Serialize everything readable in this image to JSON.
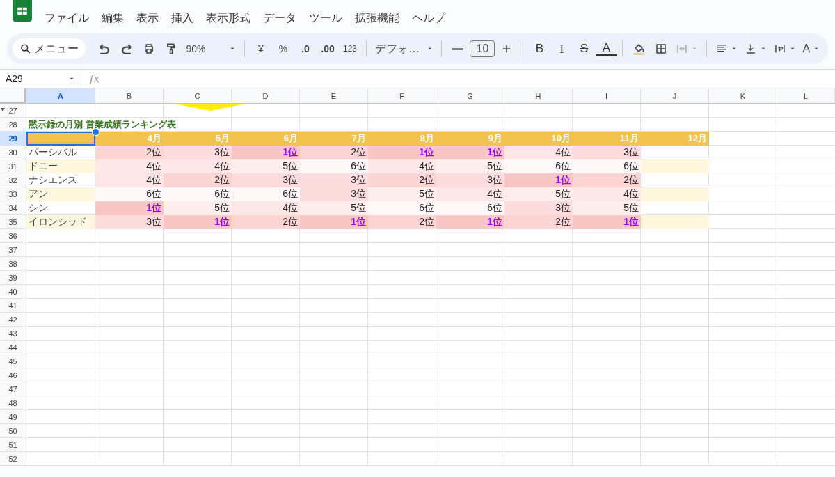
{
  "menu": [
    "ファイル",
    "編集",
    "表示",
    "挿入",
    "表示形式",
    "データ",
    "ツール",
    "拡張機能",
    "ヘルプ"
  ],
  "toolbar": {
    "search": "メニュー",
    "zoom": "90%",
    "currency": "¥",
    "percent": "%",
    "decrease_decimal": ".0",
    "increase_decimal": ".00",
    "number_format": "123",
    "font": "デフォ…",
    "font_size": "10",
    "bold": "B",
    "italic": "I",
    "strike": "S",
    "text_color": "A",
    "rotate": "A"
  },
  "name_box": "A29",
  "formula_label": "fx",
  "columns": [
    {
      "label": "A",
      "selected": true
    },
    {
      "label": "B",
      "selected": false
    },
    {
      "label": "C",
      "selected": false
    },
    {
      "label": "D",
      "selected": false
    },
    {
      "label": "E",
      "selected": false
    },
    {
      "label": "F",
      "selected": false
    },
    {
      "label": "G",
      "selected": false
    },
    {
      "label": "H",
      "selected": false
    },
    {
      "label": "I",
      "selected": false
    },
    {
      "label": "J",
      "selected": false
    },
    {
      "label": "K",
      "selected": false
    },
    {
      "label": "L",
      "selected": false
    }
  ],
  "rows": [
    {
      "number": "27",
      "kind": "empty",
      "selected": false
    },
    {
      "number": "28",
      "kind": "title",
      "selected": false,
      "title": "黙示録の月別 営業成績ランキング表"
    },
    {
      "number": "29",
      "kind": "header",
      "selected": true,
      "months": [
        "4月",
        "5月",
        "6月",
        "7月",
        "8月",
        "9月",
        "10月",
        "11月",
        "12月"
      ]
    },
    {
      "number": "30",
      "kind": "data",
      "selected": false,
      "name": "パーシバル",
      "band": false,
      "ranks": [
        {
          "text": "2位",
          "color": "#fbd4d4",
          "top": false
        },
        {
          "text": "3位",
          "color": "#fcdcdc",
          "top": false
        },
        {
          "text": "1位",
          "color": "#f9c6c6",
          "top": true
        },
        {
          "text": "2位",
          "color": "#fbd4d4",
          "top": false
        },
        {
          "text": "1位",
          "color": "#f9c6c6",
          "top": true
        },
        {
          "text": "1位",
          "color": "#f9c6c6",
          "top": true
        },
        {
          "text": "4位",
          "color": "#fde6e6",
          "top": false
        },
        {
          "text": "3位",
          "color": "#fcdcdc",
          "top": false
        }
      ]
    },
    {
      "number": "31",
      "kind": "data",
      "selected": false,
      "name": "ドニー",
      "band": true,
      "ranks": [
        {
          "text": "4位",
          "color": "#fde6e6",
          "top": false
        },
        {
          "text": "4位",
          "color": "#fde6e6",
          "top": false
        },
        {
          "text": "5位",
          "color": "#feeeee",
          "top": false
        },
        {
          "text": "6位",
          "color": "#fff8f8",
          "top": false
        },
        {
          "text": "4位",
          "color": "#fde6e6",
          "top": false
        },
        {
          "text": "5位",
          "color": "#feeeee",
          "top": false
        },
        {
          "text": "6位",
          "color": "#fff8f8",
          "top": false
        },
        {
          "text": "6位",
          "color": "#fff8f8",
          "top": false
        }
      ]
    },
    {
      "number": "32",
      "kind": "data",
      "selected": false,
      "name": "ナシエンス",
      "band": false,
      "ranks": [
        {
          "text": "4位",
          "color": "#fde6e6",
          "top": false
        },
        {
          "text": "2位",
          "color": "#fbd4d4",
          "top": false
        },
        {
          "text": "3位",
          "color": "#fcdcdc",
          "top": false
        },
        {
          "text": "3位",
          "color": "#fcdcdc",
          "top": false
        },
        {
          "text": "2位",
          "color": "#fbd4d4",
          "top": false
        },
        {
          "text": "3位",
          "color": "#fcdcdc",
          "top": false
        },
        {
          "text": "1位",
          "color": "#f9c6c6",
          "top": true
        },
        {
          "text": "2位",
          "color": "#fbd4d4",
          "top": false
        }
      ]
    },
    {
      "number": "33",
      "kind": "data",
      "selected": false,
      "name": "アン",
      "band": true,
      "ranks": [
        {
          "text": "6位",
          "color": "#fff8f8",
          "top": false
        },
        {
          "text": "6位",
          "color": "#fff8f8",
          "top": false
        },
        {
          "text": "6位",
          "color": "#fff8f8",
          "top": false
        },
        {
          "text": "3位",
          "color": "#fcdcdc",
          "top": false
        },
        {
          "text": "5位",
          "color": "#feeeee",
          "top": false
        },
        {
          "text": "4位",
          "color": "#fde6e6",
          "top": false
        },
        {
          "text": "5位",
          "color": "#feeeee",
          "top": false
        },
        {
          "text": "4位",
          "color": "#fde6e6",
          "top": false
        }
      ]
    },
    {
      "number": "34",
      "kind": "data",
      "selected": false,
      "name": "シン",
      "band": false,
      "ranks": [
        {
          "text": "1位",
          "color": "#f9c6c6",
          "top": true
        },
        {
          "text": "5位",
          "color": "#feeeee",
          "top": false
        },
        {
          "text": "4位",
          "color": "#fde6e6",
          "top": false
        },
        {
          "text": "5位",
          "color": "#feeeee",
          "top": false
        },
        {
          "text": "6位",
          "color": "#fff8f8",
          "top": false
        },
        {
          "text": "6位",
          "color": "#fff8f8",
          "top": false
        },
        {
          "text": "3位",
          "color": "#fcdcdc",
          "top": false
        },
        {
          "text": "5位",
          "color": "#feeeee",
          "top": false
        }
      ]
    },
    {
      "number": "35",
      "kind": "data",
      "selected": false,
      "name": "イロンシッド",
      "band": true,
      "ranks": [
        {
          "text": "3位",
          "color": "#fcdcdc",
          "top": false
        },
        {
          "text": "1位",
          "color": "#f9c6c6",
          "top": true
        },
        {
          "text": "2位",
          "color": "#fbd4d4",
          "top": false
        },
        {
          "text": "1位",
          "color": "#f9c6c6",
          "top": true
        },
        {
          "text": "2位",
          "color": "#fbd4d4",
          "top": false
        },
        {
          "text": "1位",
          "color": "#f9c6c6",
          "top": true
        },
        {
          "text": "2位",
          "color": "#fbd4d4",
          "top": false
        },
        {
          "text": "1位",
          "color": "#f9c6c6",
          "top": true
        }
      ]
    },
    {
      "number": "36",
      "kind": "empty",
      "selected": false
    },
    {
      "number": "37",
      "kind": "empty",
      "selected": false
    },
    {
      "number": "38",
      "kind": "empty",
      "selected": false
    },
    {
      "number": "39",
      "kind": "empty",
      "selected": false
    },
    {
      "number": "40",
      "kind": "empty",
      "selected": false
    },
    {
      "number": "41",
      "kind": "empty",
      "selected": false
    },
    {
      "number": "42",
      "kind": "empty",
      "selected": false
    },
    {
      "number": "43",
      "kind": "empty",
      "selected": false
    },
    {
      "number": "44",
      "kind": "empty",
      "selected": false
    },
    {
      "number": "45",
      "kind": "empty",
      "selected": false
    },
    {
      "number": "46",
      "kind": "empty",
      "selected": false
    },
    {
      "number": "47",
      "kind": "empty",
      "selected": false
    },
    {
      "number": "48",
      "kind": "empty",
      "selected": false
    },
    {
      "number": "49",
      "kind": "empty",
      "selected": false
    },
    {
      "number": "50",
      "kind": "empty",
      "selected": false
    },
    {
      "number": "51",
      "kind": "empty",
      "selected": false
    },
    {
      "number": "52",
      "kind": "empty",
      "selected": false
    }
  ]
}
